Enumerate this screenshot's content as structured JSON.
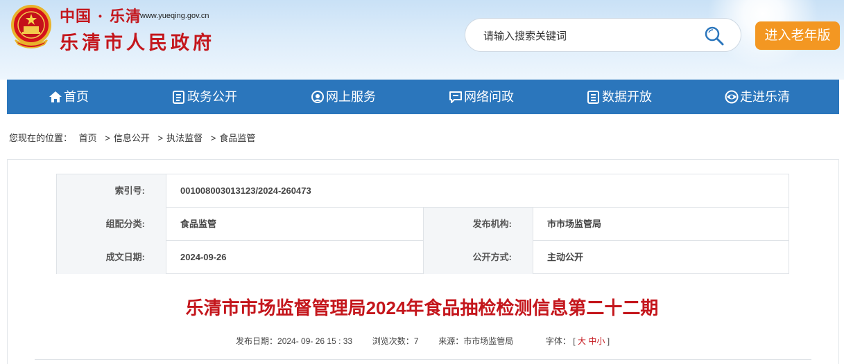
{
  "header": {
    "site_name": "中国 · 乐清",
    "site_url": "www.yueqing.gov.cn",
    "site_title": "乐清市人民政府",
    "search_placeholder": "请输入搜索关键词",
    "elder_button": "进入老年版"
  },
  "nav": {
    "items": [
      {
        "label": "首页",
        "icon": "home-icon"
      },
      {
        "label": "政务公开",
        "icon": "document-icon"
      },
      {
        "label": "网上服务",
        "icon": "service-icon"
      },
      {
        "label": "网络问政",
        "icon": "chat-icon"
      },
      {
        "label": "数据开放",
        "icon": "data-icon"
      },
      {
        "label": "走进乐清",
        "icon": "eye-icon"
      }
    ]
  },
  "breadcrumb": {
    "prefix": "您现在的位置：",
    "items": [
      "首页",
      "信息公开",
      "执法监督",
      "食品监管"
    ],
    "separator": ">"
  },
  "meta": {
    "index_label": "索引号:",
    "index_value": "001008003013123/2024-260473",
    "category_label": "组配分类:",
    "category_value": "食品监管",
    "publisher_label": "发布机构:",
    "publisher_value": "市市场监管局",
    "date_label": "成文日期:",
    "date_value": "2024-09-26",
    "disclosure_label": "公开方式:",
    "disclosure_value": "主动公开"
  },
  "article": {
    "title": "乐清市市场监督管理局2024年食品抽检检测信息第二十二期",
    "publish_label": "发布日期：",
    "publish_value": "2024- 09- 26 15 : 33",
    "views_label": "浏览次数：",
    "views_value": "7",
    "source_label": "来源：",
    "source_value": "市市场监管局",
    "font_label": "字体：",
    "font_open": "[",
    "font_large": "大",
    "font_medium": "中",
    "font_small": "小",
    "font_close": "]"
  },
  "colors": {
    "nav_bg": "#2b76bc",
    "title_red": "#c4161c",
    "elder_orange": "#f39722"
  }
}
